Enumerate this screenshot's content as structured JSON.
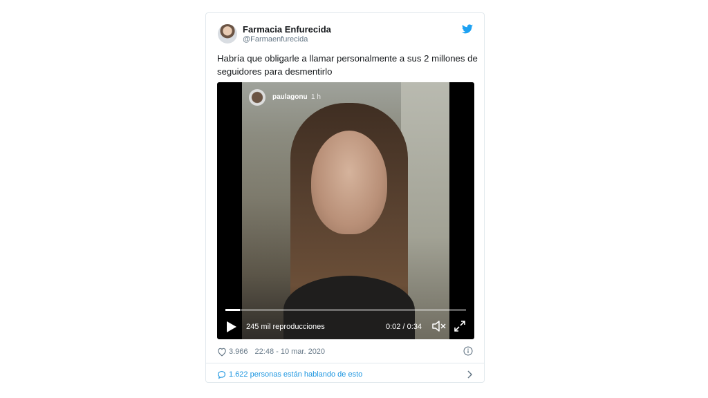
{
  "tweet": {
    "author_name": "Farmacia Enfurecida",
    "author_handle": "@Farmaenfurecida",
    "text": "Habría que obligarle a llamar personalmente a sus 2 millones de seguidores para desmentirlo",
    "likes": "3.966",
    "datetime": "22:48 - 10 mar. 2020",
    "conversation_text": "1.622 personas están hablando de esto"
  },
  "video": {
    "story_user": "paulagonu",
    "story_time": "1 h",
    "views": "245 mil reproducciones",
    "time": "0:02 / 0:34",
    "progress": 0.06
  },
  "icons": {
    "bird": "twitter-bird-icon",
    "play": "play-icon",
    "volume": "volume-muted-icon",
    "fullscreen": "fullscreen-icon",
    "heart": "heart-icon",
    "info": "info-icon",
    "bubble": "speech-bubble-icon",
    "chevron": "chevron-right-icon"
  },
  "colors": {
    "twitter_blue": "#1da1f2",
    "link_blue": "#1b95e0",
    "muted": "#657786",
    "border": "#e1e8ed"
  }
}
